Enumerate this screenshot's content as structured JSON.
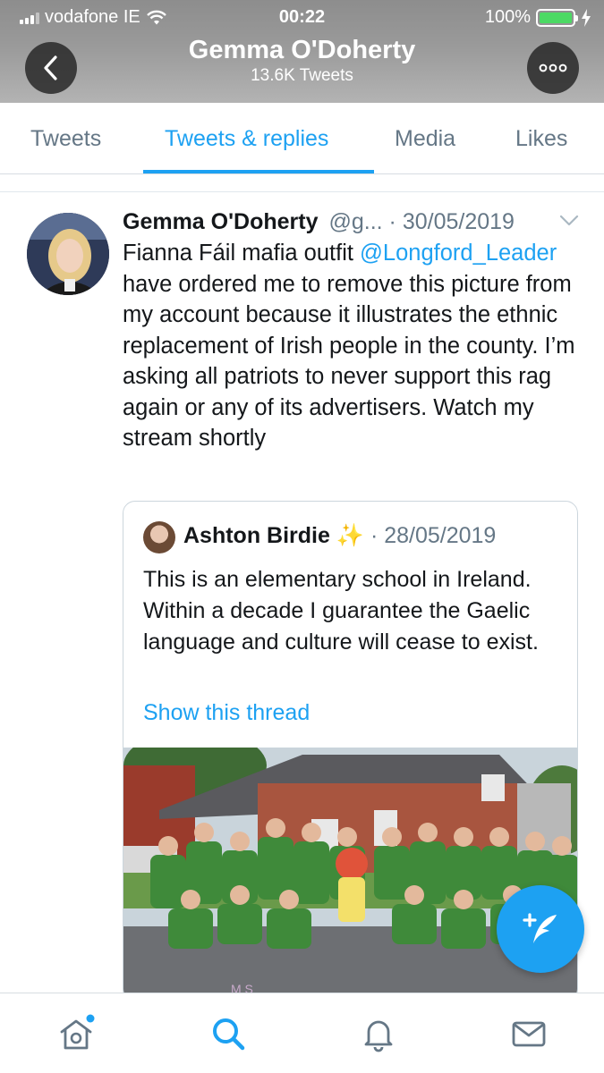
{
  "status_bar": {
    "carrier": "vodafone IE",
    "time": "00:22",
    "battery": "100%",
    "signal_bars": 3,
    "icons": [
      "signal-icon",
      "wifi-icon",
      "battery-icon",
      "charging-icon"
    ]
  },
  "header": {
    "title": "Gemma O'Doherty",
    "subtitle": "13.6K Tweets",
    "back_icon": "chevron-left-icon",
    "more_icon": "more-dots-icon"
  },
  "tabs": [
    {
      "label": "Tweets",
      "active": false
    },
    {
      "label": "Tweets & replies",
      "active": true
    },
    {
      "label": "Media",
      "active": false
    },
    {
      "label": "Likes",
      "active": false
    }
  ],
  "tweet": {
    "author_name": "Gemma O'Doherty",
    "author_handle": "@g...",
    "separator": " · ",
    "date": "30/05/2019",
    "text_before": "Fianna Fáil mafia outfit ",
    "mention": "@Longford_Leader",
    "text_after": " have ordered me to remove this picture from my account because it illustrates the ethnic replacement of Irish people in the county. I’m asking all patriots to never support this rag again or any of its advertisers. Watch my stream shortly",
    "quote": {
      "author_name": "Ashton Birdie",
      "sparkle": "✨",
      "separator": " · ",
      "date": "28/05/2019",
      "text": "This is an elementary school in Ireland. Within a decade I guarantee the Gaelic language and culture will cease to exist.",
      "link": "Show this thread"
    }
  },
  "fab": {
    "icon": "compose-tweet-icon"
  },
  "bottom_nav": [
    {
      "icon": "home-icon",
      "has_notification_dot": true
    },
    {
      "icon": "search-icon",
      "active": true
    },
    {
      "icon": "notifications-icon"
    },
    {
      "icon": "messages-icon"
    }
  ],
  "colors": {
    "accent": "#1da1f2",
    "secondary_text": "#657786",
    "primary_text": "#14171a",
    "border": "#ccd6dd"
  }
}
